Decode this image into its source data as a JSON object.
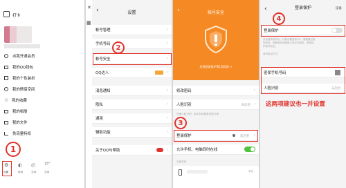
{
  "steps": [
    "1",
    "2",
    "3",
    "4"
  ],
  "p1": {
    "signin": "打卡",
    "menu": [
      "点我开通会员",
      "我的QQ钱包",
      "我的个性装扮",
      "我的情侣空间",
      "我的收藏",
      "我的相册",
      "我的文件",
      "免流量特权"
    ],
    "bottom": [
      "设置",
      "夜间",
      "当地",
      "18°",
      "当地"
    ]
  },
  "p2": {
    "title": "设置",
    "rows": [
      "帐号管理",
      "手机号码",
      "帐号安全",
      "QQ达人",
      "消息通知",
      "隐私",
      "通用",
      "辅助功能",
      "关于QQ与帮助"
    ]
  },
  "p3": {
    "title": "帐号安全",
    "tip": "发现登录保护等1项风险 >",
    "rows": [
      "修改密码",
      "人脸识别",
      "登录保护",
      "允许手机、电脑同时在线"
    ],
    "not_enabled": "未启用",
    "note": "开通人脸识别，新手机设备登录更方便",
    "online": "当前在线",
    "device": "本机"
  },
  "p4": {
    "title": "登录保护",
    "more": "设备",
    "protect": "登录保护",
    "desc1": "开启登录保护后，在新设备登录QQ，需要通过身",
    "desc2": "份验证。即便密码泄露他人也无法登录，有效保",
    "desc3": "护帐号安全。",
    "verify": "身份验证方式",
    "phone": "密保手机号码",
    "face": "人脸识别",
    "not_enabled": "未启用",
    "note": "这两项建议也一并设置"
  }
}
